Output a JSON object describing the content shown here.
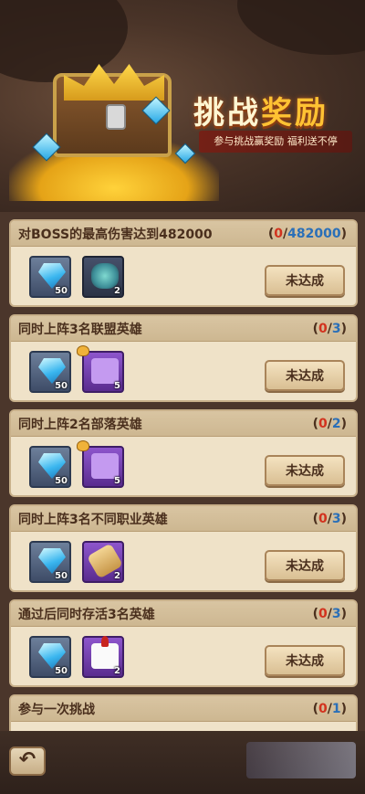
{
  "banner": {
    "title_part1": "挑战",
    "title_part2": "奖励",
    "subtitle": "参与挑战赢奖励 福利送不停"
  },
  "tasks": [
    {
      "title": "对BOSS的最高伤害达到482000",
      "progress_current": "0",
      "progress_sep": "/",
      "progress_total": "482000",
      "button_label": "未达成",
      "rewards": [
        {
          "icon": "blue-diamond-icon",
          "qty": "50"
        },
        {
          "icon": "teal-rune-icon",
          "qty": "2"
        }
      ]
    },
    {
      "title": "同时上阵3名联盟英雄",
      "progress_current": "0",
      "progress_sep": "/",
      "progress_total": "3",
      "button_label": "未达成",
      "rewards": [
        {
          "icon": "blue-diamond-icon",
          "qty": "50"
        },
        {
          "icon": "alliance-emblem-icon",
          "qty": "5"
        }
      ]
    },
    {
      "title": "同时上阵2名部落英雄",
      "progress_current": "0",
      "progress_sep": "/",
      "progress_total": "2",
      "button_label": "未达成",
      "rewards": [
        {
          "icon": "blue-diamond-icon",
          "qty": "50"
        },
        {
          "icon": "horde-emblem-icon",
          "qty": "5"
        }
      ]
    },
    {
      "title": "同时上阵3名不同职业英雄",
      "progress_current": "0",
      "progress_sep": "/",
      "progress_total": "3",
      "button_label": "未达成",
      "rewards": [
        {
          "icon": "blue-diamond-icon",
          "qty": "50"
        },
        {
          "icon": "scroll-icon",
          "qty": "2"
        }
      ]
    },
    {
      "title": "通过后同时存活3名英雄",
      "progress_current": "0",
      "progress_sep": "/",
      "progress_total": "3",
      "button_label": "未达成",
      "rewards": [
        {
          "icon": "blue-diamond-icon",
          "qty": "50"
        },
        {
          "icon": "dice-icon",
          "qty": "2"
        }
      ]
    },
    {
      "title": "参与一次挑战",
      "progress_current": "0",
      "progress_sep": "/",
      "progress_total": "1"
    }
  ],
  "nav": {
    "back_label": "↶"
  }
}
